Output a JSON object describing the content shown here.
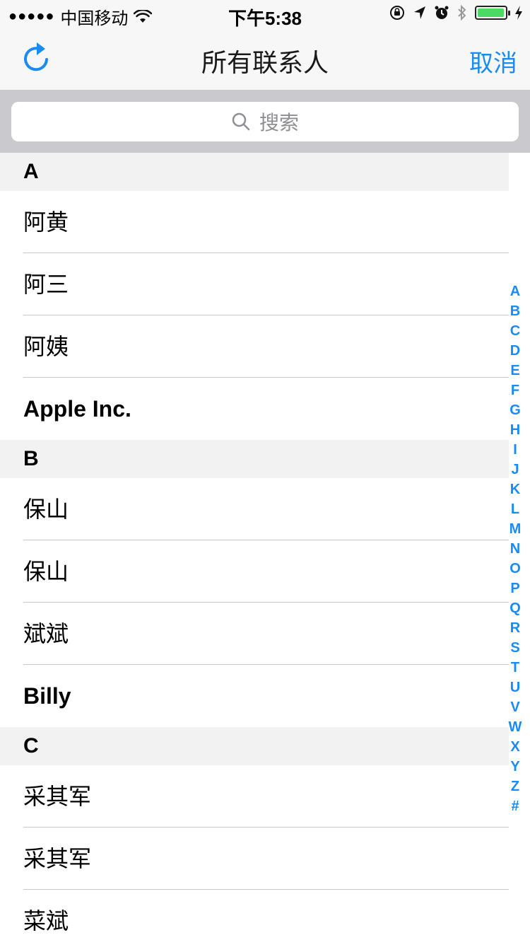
{
  "status_bar": {
    "signal": "●●●●●",
    "carrier": "中国移动",
    "time": "下午5:38"
  },
  "nav": {
    "title": "所有联系人",
    "cancel_label": "取消"
  },
  "search": {
    "placeholder": "搜索"
  },
  "sections": [
    {
      "letter": "A",
      "contacts": [
        {
          "name": "阿黄",
          "bold": false
        },
        {
          "name": "阿三",
          "bold": false
        },
        {
          "name": "阿姨",
          "bold": false
        },
        {
          "name": "Apple Inc.",
          "bold": true
        }
      ]
    },
    {
      "letter": "B",
      "contacts": [
        {
          "name": "保山",
          "bold": false
        },
        {
          "name": "保山",
          "bold": false
        },
        {
          "name": "斌斌",
          "bold": false
        },
        {
          "name": "Billy",
          "bold": true
        }
      ]
    },
    {
      "letter": "C",
      "contacts": [
        {
          "name": "采其军",
          "bold": false
        },
        {
          "name": "采其军",
          "bold": false
        },
        {
          "name": "菜斌",
          "bold": false
        }
      ]
    }
  ],
  "index": [
    "A",
    "B",
    "C",
    "D",
    "E",
    "F",
    "G",
    "H",
    "I",
    "J",
    "K",
    "L",
    "M",
    "N",
    "O",
    "P",
    "Q",
    "R",
    "S",
    "T",
    "U",
    "V",
    "W",
    "X",
    "Y",
    "Z",
    "#"
  ],
  "colors": {
    "accent": "#1a8bf0",
    "battery": "#4cd964",
    "section_bg": "#f2f2f2"
  }
}
